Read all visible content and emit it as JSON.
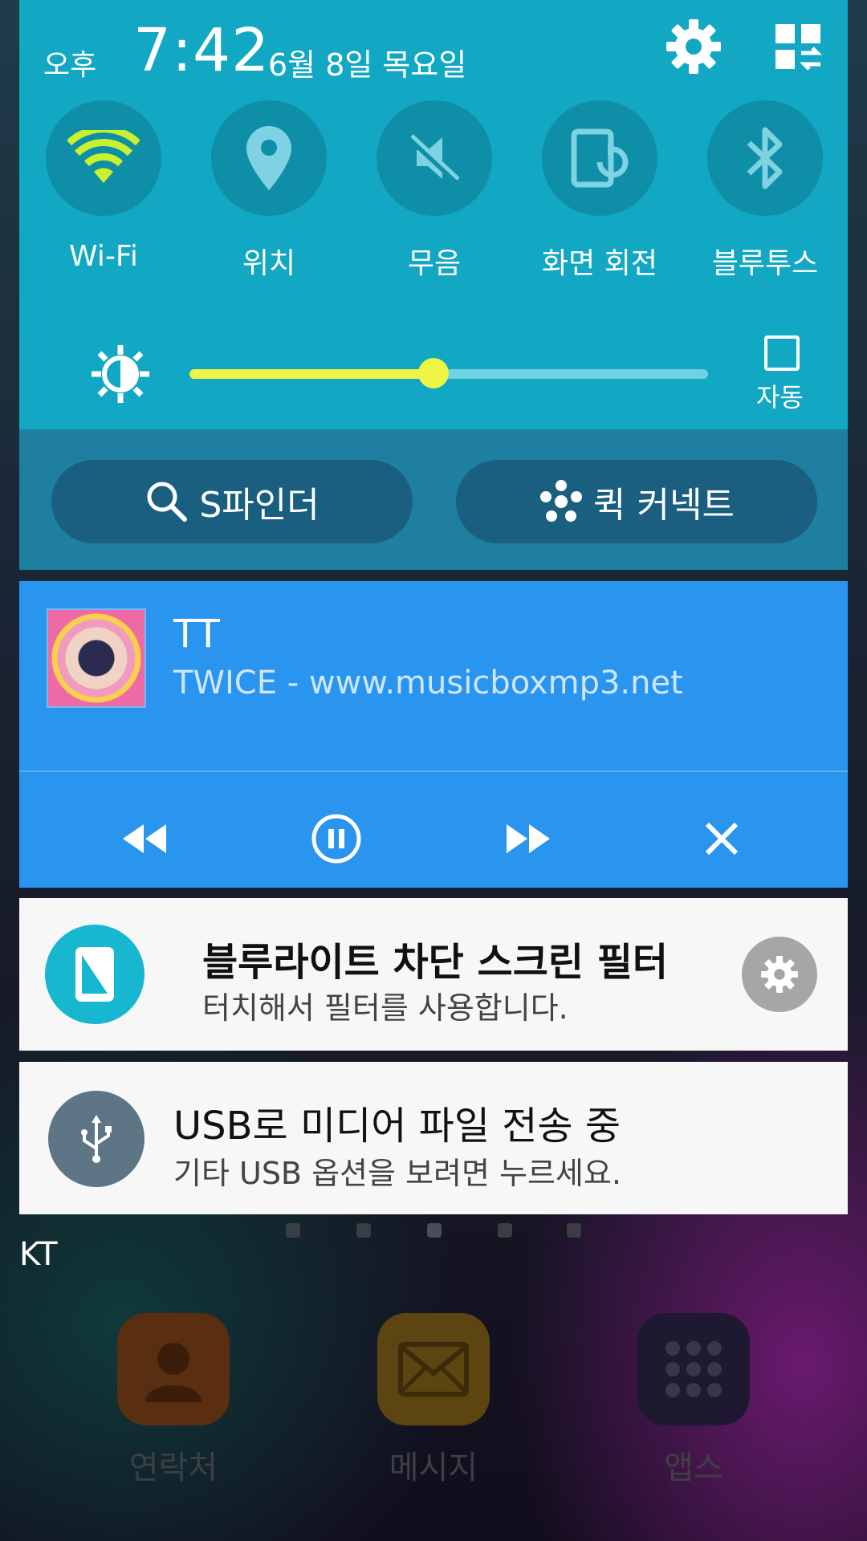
{
  "status": {
    "ampm": "오후",
    "time": "7:42",
    "date": "6월 8일 목요일"
  },
  "quick_toggles": [
    {
      "label": "Wi-Fi",
      "icon": "wifi-icon",
      "active": true
    },
    {
      "label": "위치",
      "icon": "location-icon",
      "active": false
    },
    {
      "label": "무음",
      "icon": "mute-icon",
      "active": false
    },
    {
      "label": "화면 회전",
      "icon": "rotate-icon",
      "active": false
    },
    {
      "label": "블루투스",
      "icon": "bluetooth-icon",
      "active": false
    }
  ],
  "brightness": {
    "level": 0.47,
    "auto_label": "자동",
    "auto_checked": false
  },
  "panel_buttons": {
    "finder": "S파인더",
    "quick_connect": "퀵 커넥트"
  },
  "music": {
    "title": "TT",
    "subtitle": "TWICE - www.musicboxmp3.net",
    "state": "playing"
  },
  "notifications": [
    {
      "title": "블루라이트 차단 스크린 필터",
      "subtitle": "터치해서 필터를 사용합니다.",
      "icon": "phone-filter-icon",
      "icon_color": "#16b7cf"
    },
    {
      "title": "USB로 미디어 파일 전송 중",
      "subtitle": "기타 USB 옵션을 보려면 누르세요.",
      "icon": "usb-icon",
      "icon_color": "#5d7585"
    }
  ],
  "home": {
    "carrier": "KT",
    "dock": [
      {
        "label": "연락처",
        "icon": "contacts-icon",
        "color": "#5a2e10"
      },
      {
        "label": "메시지",
        "icon": "message-icon",
        "color": "#5c4511"
      },
      {
        "label": "앱스",
        "icon": "apps-icon",
        "color": "#1e1830"
      }
    ]
  },
  "colors": {
    "panel": "#12a7c3",
    "music_bg": "#2a95ef",
    "slider_active": "#eef545"
  }
}
